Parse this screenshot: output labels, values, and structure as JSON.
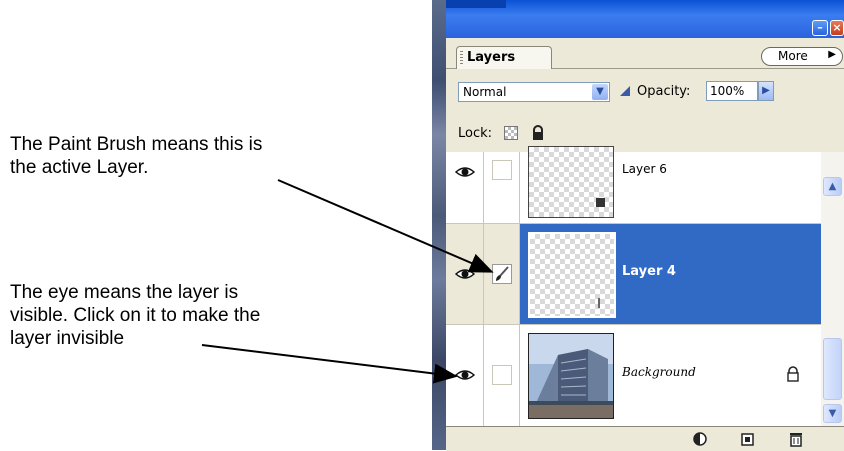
{
  "annotations": {
    "brush_line1": "The Paint Brush means this is",
    "brush_line2": "the active Layer.",
    "eye_line1": "The eye means the layer is",
    "eye_line2": "visible.  Click on it to make the",
    "eye_line3": "layer invisible"
  },
  "panel": {
    "tab_label": "Layers",
    "more_label": "More",
    "blend_mode": "Normal",
    "opacity_label": "Opacity:",
    "opacity_value": "100%",
    "lock_label": "Lock:",
    "layers": [
      {
        "name": "Layer 6",
        "visible": true,
        "active": false
      },
      {
        "name": "Layer 4",
        "visible": true,
        "active": true
      },
      {
        "name": "Background",
        "visible": true,
        "active": false,
        "locked": true
      }
    ]
  },
  "colors": {
    "active_row": "#316ac5",
    "panel_bg": "#ece9d8",
    "titlebar": "#2a63dc"
  },
  "icons": [
    "eye-icon",
    "paintbrush-icon",
    "lock-icon",
    "minimize-icon",
    "close-icon",
    "new-layer-icon",
    "trash-icon",
    "adjustment-layer-icon"
  ]
}
